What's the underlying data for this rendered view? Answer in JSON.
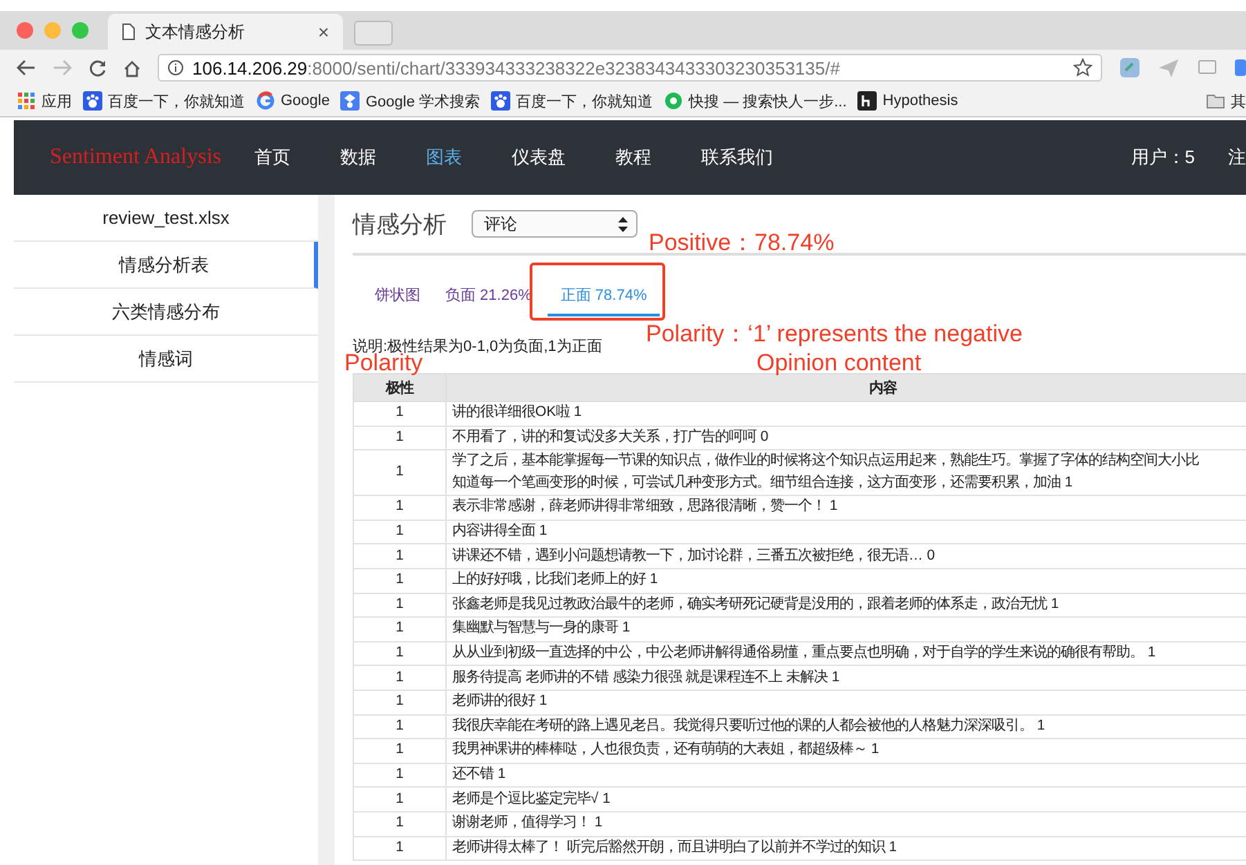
{
  "browser": {
    "tab_title": "文本情感分析",
    "tab_close": "×",
    "url_host": "106.14.206.29",
    "url_path": ":8000/senti/chart/333934333238322e3238343433303230353135/#",
    "bookmarks": [
      {
        "label": "应用",
        "kind": "apps"
      },
      {
        "label": "百度一下，你就知道",
        "kind": "paw"
      },
      {
        "label": "Google",
        "kind": "google"
      },
      {
        "label": "Google 学术搜索",
        "kind": "scholar"
      },
      {
        "label": "百度一下，你就知道",
        "kind": "paw"
      },
      {
        "label": "快搜 — 搜索快人一步...",
        "kind": "kuaisou"
      },
      {
        "label": "Hypothesis",
        "kind": "hypo"
      },
      {
        "label": "其",
        "kind": "folder"
      }
    ]
  },
  "navbar": {
    "brand": "Sentiment Analysis",
    "items": [
      {
        "label": "首页",
        "selected": false
      },
      {
        "label": "数据",
        "selected": false
      },
      {
        "label": "图表",
        "selected": true
      },
      {
        "label": "仪表盘",
        "selected": false
      },
      {
        "label": "教程",
        "selected": false
      },
      {
        "label": "联系我们",
        "selected": false
      }
    ],
    "user": "用户：5",
    "logout": "注"
  },
  "sidebar": {
    "items": [
      {
        "label": "review_test.xlsx",
        "selected": false
      },
      {
        "label": "情感分析表",
        "selected": true
      },
      {
        "label": "六类情感分布",
        "selected": false
      },
      {
        "label": "情感词",
        "selected": false
      }
    ]
  },
  "content": {
    "title": "情感分析",
    "select": "评论",
    "tabs": [
      {
        "label": "饼状图",
        "selected": false
      },
      {
        "label": "负面 21.26%",
        "selected": false
      },
      {
        "label": "正面 78.74%",
        "selected": true
      }
    ],
    "note": "说明:极性结果为0-1,0为负面,1为正面"
  },
  "annotations": {
    "positive": "Positive：78.74%",
    "polarity_note": "Polarity：‘1’ represents the negative",
    "opinion": "Opinion content",
    "polarity": "Polarity"
  },
  "table": {
    "columns": [
      "极性",
      "内容"
    ],
    "rows": [
      {
        "polarity": "1",
        "content": "讲的很详细很OK啦 1"
      },
      {
        "polarity": "1",
        "content": "不用看了，讲的和复试没多大关系，打广告的呵呵 0"
      },
      {
        "polarity": "1",
        "lines": [
          "学了之后，基本能掌握每一节课的知识点，做作业的时候将这个知识点运用起来，熟能生巧。掌握了字体的结构空间大小比",
          "知道每一个笔画变形的时候，可尝试几种变形方式。细节组合连接，这方面变形，还需要积累，加油 1"
        ]
      },
      {
        "polarity": "1",
        "content": "表示非常感谢，薛老师讲得非常细致，思路很清晰，赞一个！ 1"
      },
      {
        "polarity": "1",
        "content": "内容讲得全面 1"
      },
      {
        "polarity": "1",
        "content": "讲课还不错，遇到小问题想请教一下，加讨论群，三番五次被拒绝，很无语… 0"
      },
      {
        "polarity": "1",
        "content": "上的好好哦，比我们老师上的好 1"
      },
      {
        "polarity": "1",
        "content": "张鑫老师是我见过教政治最牛的老师，确实考研死记硬背是没用的，跟着老师的体系走，政治无忧 1"
      },
      {
        "polarity": "1",
        "content": "集幽默与智慧与一身的康哥 1"
      },
      {
        "polarity": "1",
        "content": "从从业到初级一直选择的中公，中公老师讲解得通俗易懂，重点要点也明确，对于自学的学生来说的确很有帮助。 1"
      },
      {
        "polarity": "1",
        "content": "服务待提高 老师讲的不错 感染力很强 就是课程连不上 未解决 1"
      },
      {
        "polarity": "1",
        "content": "老师讲的很好 1"
      },
      {
        "polarity": "1",
        "content": "我很庆幸能在考研的路上遇见老吕。我觉得只要听过他的课的人都会被他的人格魅力深深吸引。 1"
      },
      {
        "polarity": "1",
        "content": "我男神课讲的棒棒哒，人也很负责，还有萌萌的大表姐，都超级棒～ 1"
      },
      {
        "polarity": "1",
        "content": "还不错 1"
      },
      {
        "polarity": "1",
        "content": "老师是个逗比鉴定完毕√ 1"
      },
      {
        "polarity": "1",
        "content": "谢谢老师，值得学习！ 1"
      },
      {
        "polarity": "1",
        "content": "老师讲得太棒了！ 听完后豁然开朗，而且讲明白了以前并不学过的知识 1"
      }
    ]
  }
}
